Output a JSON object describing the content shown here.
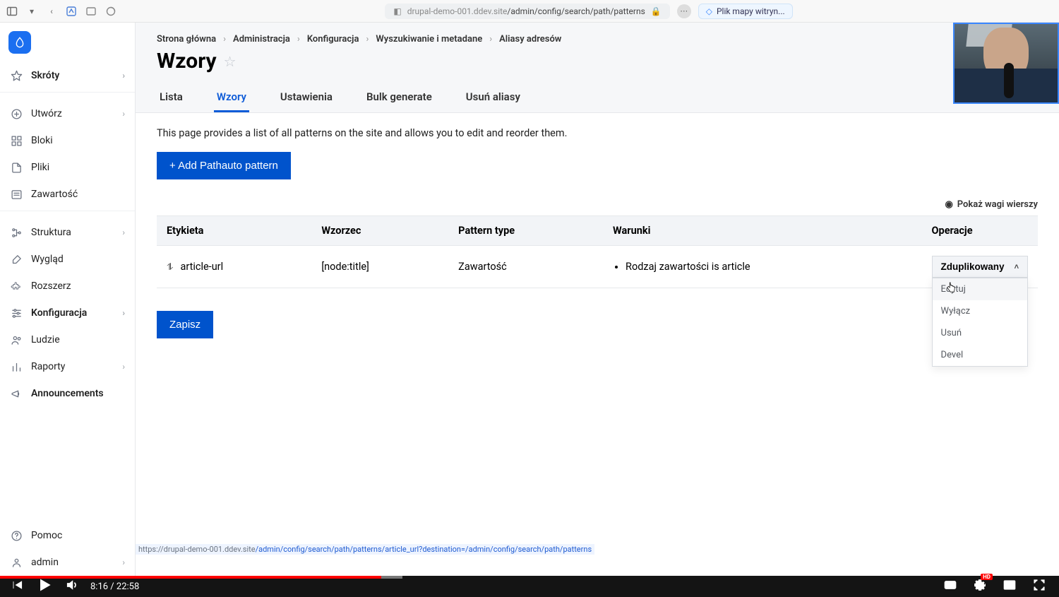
{
  "browser": {
    "url_host": "drupal-demo-001.ddev.site",
    "url_path": "/admin/config/search/path/patterns",
    "pill_label": "Plik mapy witryn..."
  },
  "sidebar": {
    "items": [
      {
        "label": "Skróty",
        "icon": "star-outline",
        "expandable": true,
        "bold": true
      },
      {
        "label": "Utwórz",
        "icon": "plus-circle",
        "expandable": true
      },
      {
        "label": "Bloki",
        "icon": "grid"
      },
      {
        "label": "Pliki",
        "icon": "file"
      },
      {
        "label": "Zawartość",
        "icon": "content"
      },
      {
        "label": "Struktura",
        "icon": "tree",
        "expandable": true
      },
      {
        "label": "Wygląd",
        "icon": "brush"
      },
      {
        "label": "Rozszerz",
        "icon": "puzzle"
      },
      {
        "label": "Konfiguracja",
        "icon": "sliders",
        "expandable": true,
        "bold": true
      },
      {
        "label": "Ludzie",
        "icon": "users"
      },
      {
        "label": "Raporty",
        "icon": "chart",
        "expandable": true
      },
      {
        "label": "Announcements",
        "icon": "megaphone",
        "bold": true
      }
    ],
    "bottom": [
      {
        "label": "Pomoc",
        "icon": "help"
      },
      {
        "label": "admin",
        "icon": "user",
        "expandable": true
      }
    ]
  },
  "breadcrumbs": [
    "Strona główna",
    "Administracja",
    "Konfiguracja",
    "Wyszukiwanie i metadane",
    "Aliasy adresów"
  ],
  "page": {
    "title": "Wzory",
    "description": "This page provides a list of all patterns on the site and allows you to edit and reorder them.",
    "add_button": "+ Add Pathauto pattern",
    "save_button": "Zapisz",
    "row_weights_label": "Pokaż wagi wierszy"
  },
  "tabs": [
    "Lista",
    "Wzory",
    "Ustawienia",
    "Bulk generate",
    "Usuń aliasy"
  ],
  "active_tab": "Wzory",
  "table": {
    "headers": {
      "label": "Etykieta",
      "pattern": "Wzorzec",
      "type": "Pattern type",
      "conditions": "Warunki",
      "operations": "Operacje"
    },
    "rows": [
      {
        "label": "article-url",
        "pattern": "[node:title]",
        "type": "Zawartość",
        "conditions": [
          "Rodzaj zawartości is article"
        ],
        "op_default": "Zduplikowany"
      }
    ],
    "op_menu": [
      "Edytuj",
      "Wyłącz",
      "Usuń",
      "Devel"
    ]
  },
  "status_url": {
    "pre": "https://drupal-demo-001.ddev.site",
    "mid": "/admin/config/search/path/patterns/article_url?destination=/admin/config/search/path/patterns"
  },
  "video": {
    "current": "8:16",
    "total": "22:58",
    "progress_pct": 36,
    "buffer_pct": 38,
    "hd": "HD"
  }
}
